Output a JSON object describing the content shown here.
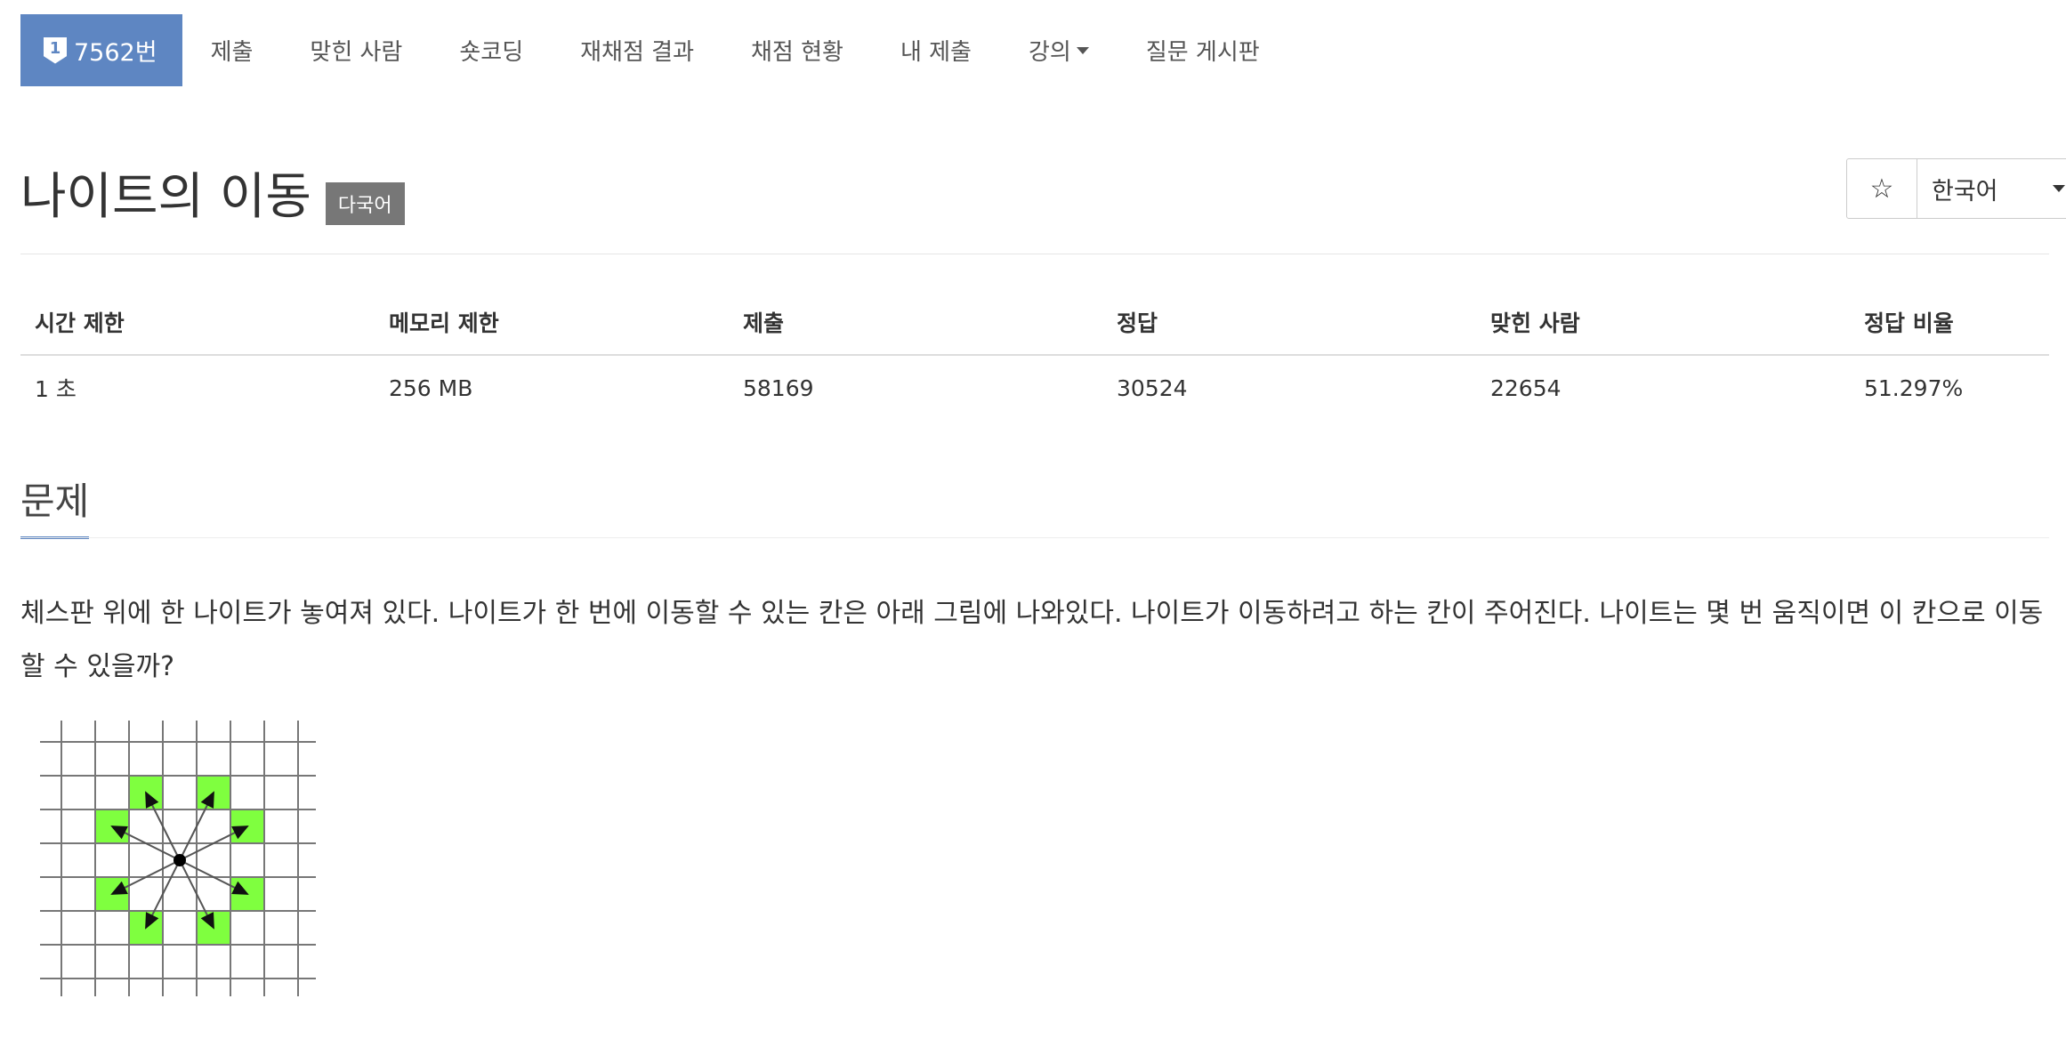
{
  "nav": {
    "problem_badge": "1",
    "problem_number": "7562번",
    "items": [
      "제출",
      "맞힌 사람",
      "숏코딩",
      "재채점 결과",
      "채점 현황",
      "내 제출",
      "강의",
      "질문 게시판"
    ]
  },
  "title": {
    "text": "나이트의 이동",
    "lang_tag": "다국어"
  },
  "actions": {
    "star_icon": "☆",
    "language": "한국어"
  },
  "stats": {
    "headers": [
      "시간 제한",
      "메모리 제한",
      "제출",
      "정답",
      "맞힌 사람",
      "정답 비율"
    ],
    "values": [
      "1 초",
      "256 MB",
      "58169",
      "30524",
      "22654",
      "51.297%"
    ]
  },
  "section": {
    "title": "문제",
    "description": "체스판 위에 한 나이트가 놓여져 있다. 나이트가 한 번에 이동할 수 있는 칸은 아래 그림에 나와있다. 나이트가 이동하려고 하는 칸이 주어진다. 나이트는 몇 번 움직이면 이 칸으로 이동할 수 있을까?"
  },
  "colors": {
    "accent": "#5e86c2",
    "highlight": "#7fff3f",
    "tag": "#777777"
  }
}
